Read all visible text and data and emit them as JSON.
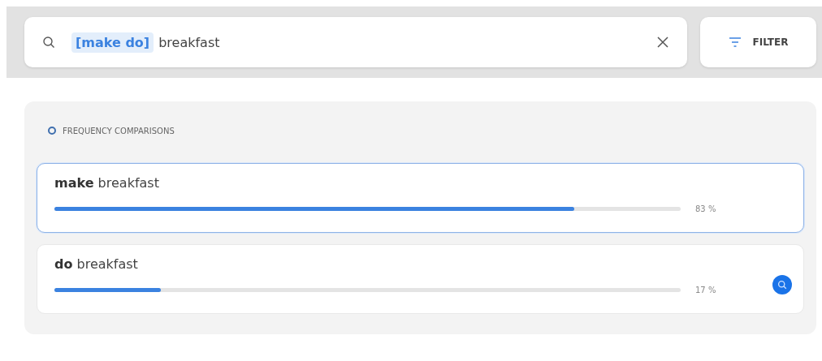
{
  "search": {
    "token": "[make do]",
    "text": "breakfast"
  },
  "filter_button": {
    "label": "FILTER"
  },
  "panel": {
    "title": "FREQUENCY COMPARISONS",
    "rows": [
      {
        "phrase": "**make** breakfast",
        "level": 0.83,
        "reading": "83 %",
        "selected": true,
        "hovered": false
      },
      {
        "phrase": "**do** breakfast",
        "level": 0.17,
        "reading": "17 %",
        "selected": false,
        "hovered": true
      }
    ]
  }
}
